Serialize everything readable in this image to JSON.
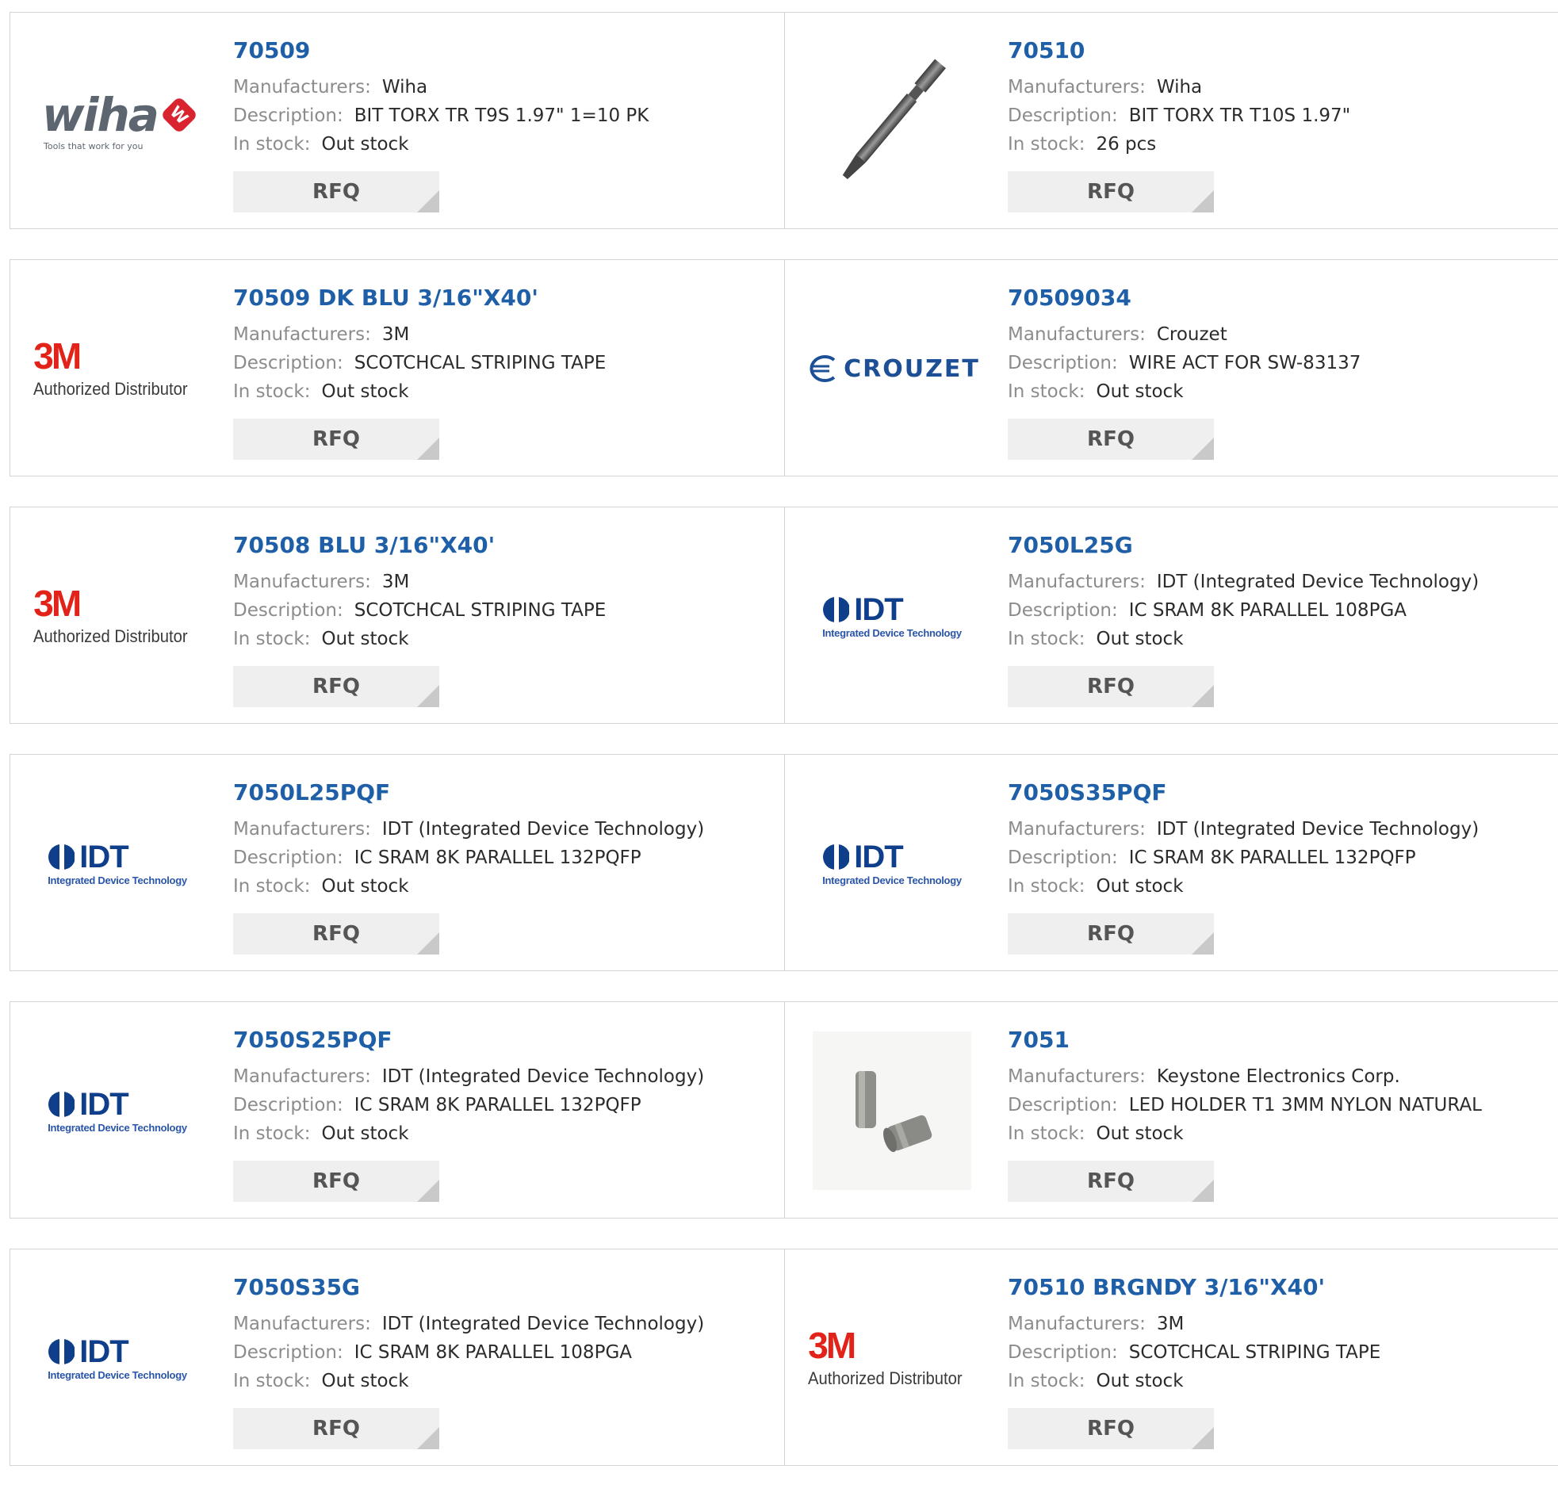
{
  "labels": {
    "manufacturers": "Manufacturers:",
    "description": "Description:",
    "in_stock": "In stock:",
    "rfq": "RFQ"
  },
  "colors": {
    "link": "#1e5fa8",
    "border": "#d5d5d5",
    "button_bg": "#efefef",
    "brand_3m": "#e2231a",
    "brand_wiha": "#5d6670",
    "brand_idt": "#0f3f8a"
  },
  "products": [
    {
      "part": "70509",
      "manufacturer": "Wiha",
      "description": "BIT TORX TR T9S 1.97\" 1=10 PK",
      "stock": "Out stock",
      "logo": "wiha"
    },
    {
      "part": "70510",
      "manufacturer": "Wiha",
      "description": "BIT TORX TR T10S 1.97\"",
      "stock": "26 pcs",
      "logo": "torx-bit-image"
    },
    {
      "part": "70509 DK BLU 3/16\"X40'",
      "manufacturer": "3M",
      "description": "SCOTCHCAL STRIPING TAPE",
      "stock": "Out stock",
      "logo": "3m"
    },
    {
      "part": "70509034",
      "manufacturer": "Crouzet",
      "description": "WIRE ACT FOR SW-83137",
      "stock": "Out stock",
      "logo": "crouzet"
    },
    {
      "part": "70508 BLU 3/16\"X40'",
      "manufacturer": "3M",
      "description": "SCOTCHCAL STRIPING TAPE",
      "stock": "Out stock",
      "logo": "3m"
    },
    {
      "part": "7050L25G",
      "manufacturer": "IDT (Integrated Device Technology)",
      "description": "IC SRAM 8K PARALLEL 108PGA",
      "stock": "Out stock",
      "logo": "idt"
    },
    {
      "part": "7050L25PQF",
      "manufacturer": "IDT (Integrated Device Technology)",
      "description": "IC SRAM 8K PARALLEL 132PQFP",
      "stock": "Out stock",
      "logo": "idt"
    },
    {
      "part": "7050S35PQF",
      "manufacturer": "IDT (Integrated Device Technology)",
      "description": "IC SRAM 8K PARALLEL 132PQFP",
      "stock": "Out stock",
      "logo": "idt"
    },
    {
      "part": "7050S25PQF",
      "manufacturer": "IDT (Integrated Device Technology)",
      "description": "IC SRAM 8K PARALLEL 132PQFP",
      "stock": "Out stock",
      "logo": "idt"
    },
    {
      "part": "7051",
      "manufacturer": "Keystone Electronics Corp.",
      "description": "LED HOLDER T1 3MM NYLON NATURAL",
      "stock": "Out stock",
      "logo": "led-holder-image"
    },
    {
      "part": "7050S35G",
      "manufacturer": "IDT (Integrated Device Technology)",
      "description": "IC SRAM 8K PARALLEL 108PGA",
      "stock": "Out stock",
      "logo": "idt"
    },
    {
      "part": "70510 BRGNDY 3/16\"X40'",
      "manufacturer": "3M",
      "description": "SCOTCHCAL STRIPING TAPE",
      "stock": "Out stock",
      "logo": "3m"
    }
  ],
  "brand_text": {
    "wiha_word": "wiha",
    "wiha_tagline": "Tools that work for you",
    "m3_mark": "3M",
    "m3_sub": "Authorized Distributor",
    "idt_word": "IDT",
    "idt_sub": "Integrated Device Technology",
    "crouzet_word": "CROUZET"
  }
}
